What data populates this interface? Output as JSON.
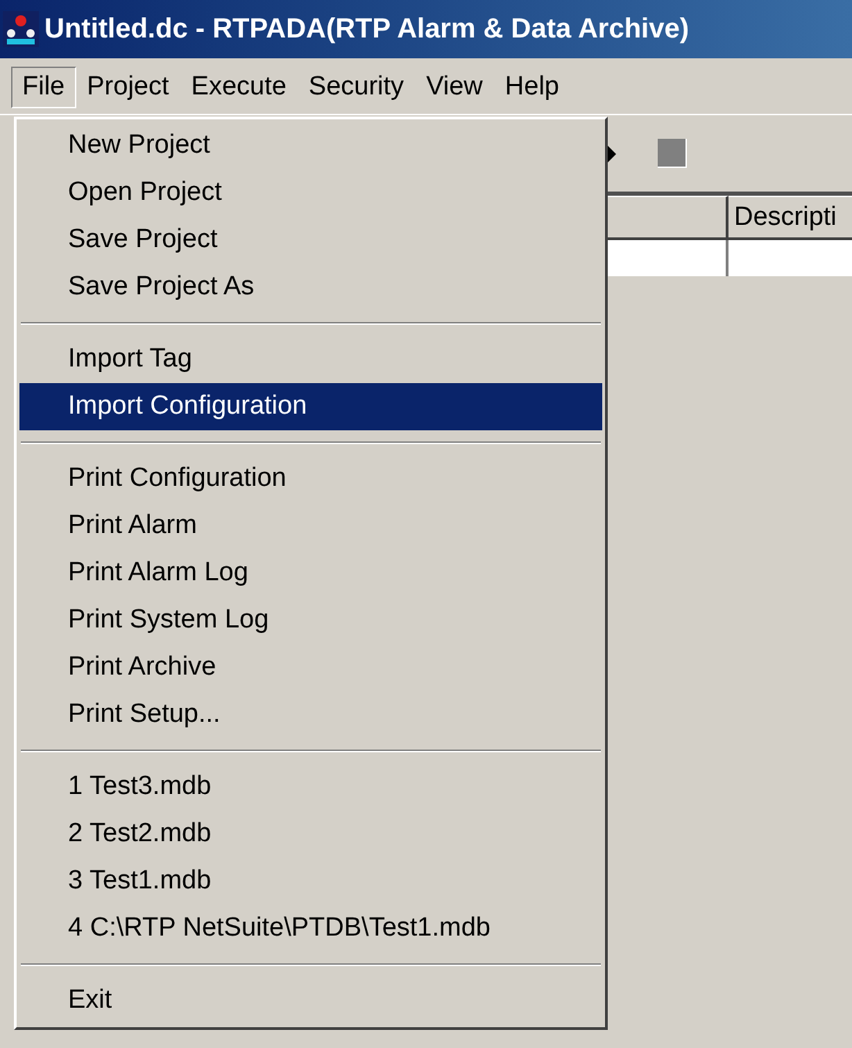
{
  "window": {
    "title": "Untitled.dc - RTPADA(RTP Alarm & Data Archive)"
  },
  "menu_bar": [
    {
      "label": "File",
      "selected": true
    },
    {
      "label": "Project",
      "selected": false
    },
    {
      "label": "Execute",
      "selected": false
    },
    {
      "label": "Security",
      "selected": false
    },
    {
      "label": "View",
      "selected": false
    },
    {
      "label": "Help",
      "selected": false
    }
  ],
  "file_menu": [
    [
      {
        "label": "New Project",
        "selected": false
      },
      {
        "label": "Open Project",
        "selected": false
      },
      {
        "label": "Save Project",
        "selected": false
      },
      {
        "label": "Save Project As",
        "selected": false
      }
    ],
    [
      {
        "label": "Import Tag",
        "selected": false
      },
      {
        "label": "Import Configuration",
        "selected": true
      }
    ],
    [
      {
        "label": "Print Configuration",
        "selected": false
      },
      {
        "label": "Print Alarm",
        "selected": false
      },
      {
        "label": "Print Alarm Log",
        "selected": false
      },
      {
        "label": "Print System Log",
        "selected": false
      },
      {
        "label": "Print Archive",
        "selected": false
      },
      {
        "label": "Print Setup...",
        "selected": false
      }
    ],
    [
      {
        "label": "1 Test3.mdb",
        "selected": false
      },
      {
        "label": "2 Test2.mdb",
        "selected": false
      },
      {
        "label": "3 Test1.mdb",
        "selected": false
      },
      {
        "label": "4 C:\\RTP NetSuite\\PTDB\\Test1.mdb",
        "selected": false
      }
    ],
    [
      {
        "label": "Exit",
        "selected": false
      }
    ]
  ],
  "table": {
    "columns": [
      "Descripti"
    ]
  }
}
